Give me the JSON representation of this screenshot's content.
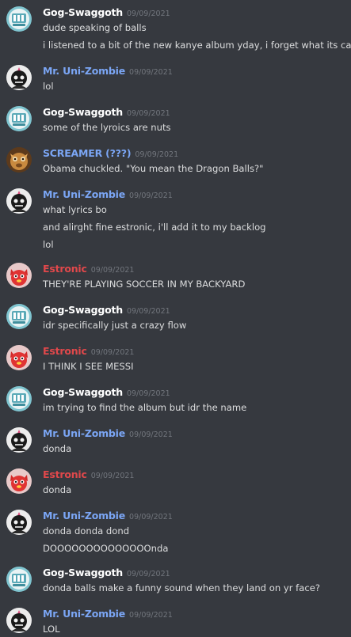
{
  "colors": {
    "background": "#36393f",
    "text": "#dcddde",
    "timestamp": "#72767d"
  },
  "users": {
    "gog": {
      "name": "Gog-Swaggoth",
      "color": "#ffffff",
      "avatar": "teal-badge-avatar"
    },
    "uni": {
      "name": "Mr. Uni-Zombie",
      "color": "#7ba6f5",
      "avatar": "zombie-avatar"
    },
    "scr": {
      "name": "SCREAMER (???)",
      "color": "#7ba6f5",
      "avatar": "brown-creature-avatar"
    },
    "est": {
      "name": "Estronic",
      "color": "#e0484b",
      "avatar": "red-cat-avatar"
    }
  },
  "messages": [
    {
      "user": "gog",
      "time": "09/09/2021",
      "lines": [
        "dude speaking of balls",
        "i listened to a bit of the new kanye album yday, i forget what its called"
      ]
    },
    {
      "user": "uni",
      "time": "09/09/2021",
      "lines": [
        "lol"
      ]
    },
    {
      "user": "gog",
      "time": "09/09/2021",
      "lines": [
        "some of  the lyroics are nuts"
      ]
    },
    {
      "user": "scr",
      "time": "09/09/2021",
      "lines": [
        "Obama chuckled. \"You mean the Dragon Balls?\""
      ]
    },
    {
      "user": "uni",
      "time": "09/09/2021",
      "lines": [
        "what lyrics bo",
        "and alirght fine estronic, i'll add it to my backlog",
        "lol"
      ]
    },
    {
      "user": "est",
      "time": "09/09/2021",
      "lines": [
        "THEY'RE PLAYING SOCCER IN MY BACKYARD"
      ]
    },
    {
      "user": "gog",
      "time": "09/09/2021",
      "lines": [
        "idr specifically just a crazy flow"
      ]
    },
    {
      "user": "est",
      "time": "09/09/2021",
      "lines": [
        "I THINK I SEE MESSI"
      ]
    },
    {
      "user": "gog",
      "time": "09/09/2021",
      "lines": [
        "im trying to find the album but idr the name"
      ]
    },
    {
      "user": "uni",
      "time": "09/09/2021",
      "lines": [
        "donda"
      ]
    },
    {
      "user": "est",
      "time": "09/09/2021",
      "lines": [
        "donda"
      ]
    },
    {
      "user": "uni",
      "time": "09/09/2021",
      "lines": [
        "donda donda dond",
        "DOOOOOOOOOOOOOOnda"
      ]
    },
    {
      "user": "gog",
      "time": "09/09/2021",
      "lines": [
        "donda balls make a funny sound when they land on yr face?"
      ]
    },
    {
      "user": "uni",
      "time": "09/09/2021",
      "lines": [
        "LOL"
      ]
    }
  ]
}
